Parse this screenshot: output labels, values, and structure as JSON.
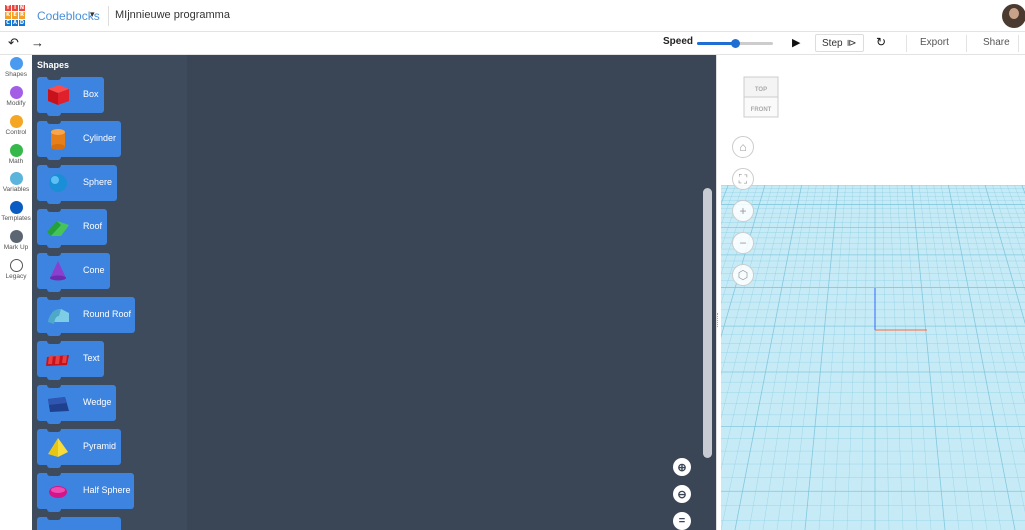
{
  "header": {
    "logo_letters": [
      "T",
      "I",
      "N",
      "K",
      "E",
      "R",
      "C",
      "A",
      "D"
    ],
    "logo_colors": [
      "#e8463e",
      "#e8463e",
      "#e8463e",
      "#f2a028",
      "#f2a028",
      "#f2a028",
      "#1477d4",
      "#1477d4",
      "#1477d4"
    ],
    "app_name": "Codeblocks",
    "app_caret": "▾",
    "project_name": "MIjnnieuwe programma"
  },
  "toolbar": {
    "undo_icon": "↶",
    "redo_icon": "→",
    "speed_label": "Speed",
    "speed_value": 0.5,
    "play_icon": "▶",
    "step_label": "Step",
    "step_icon": "⧐",
    "reset_icon": "↻",
    "export_label": "Export",
    "share_label": "Share"
  },
  "categories": [
    {
      "label": "Shapes",
      "color": "#4a9af0"
    },
    {
      "label": "Modify",
      "color": "#a45ee5"
    },
    {
      "label": "Control",
      "color": "#f5a623"
    },
    {
      "label": "Math",
      "color": "#36b84b"
    },
    {
      "label": "Variables",
      "color": "#5ab4dc"
    },
    {
      "label": "Templates",
      "color": "#0a5cc2"
    },
    {
      "label": "Mark Up",
      "color": "#5c6672"
    },
    {
      "label": "Legacy",
      "color": "#ffffff"
    }
  ],
  "flyout": {
    "title": "Shapes",
    "blocks": [
      {
        "label": "Box",
        "icon": "box-icon"
      },
      {
        "label": "Cylinder",
        "icon": "cylinder-icon"
      },
      {
        "label": "Sphere",
        "icon": "sphere-icon"
      },
      {
        "label": "Roof",
        "icon": "roof-icon"
      },
      {
        "label": "Cone",
        "icon": "cone-icon"
      },
      {
        "label": "Round Roof",
        "icon": "round-roof-icon"
      },
      {
        "label": "Text",
        "icon": "text-shape-icon"
      },
      {
        "label": "Wedge",
        "icon": "wedge-icon"
      },
      {
        "label": "Pyramid",
        "icon": "pyramid-icon"
      },
      {
        "label": "Half Sphere",
        "icon": "half-sphere-icon"
      }
    ]
  },
  "workspace": {
    "zoom_in_icon": "⊕",
    "zoom_out_icon": "⊖",
    "zoom_reset_icon": "="
  },
  "viewer": {
    "cube_top": "TOP",
    "cube_front": "FRONT",
    "nav": [
      "home-icon",
      "fit-icon",
      "zoom-in-icon",
      "zoom-out-icon",
      "view-cube-icon"
    ]
  }
}
